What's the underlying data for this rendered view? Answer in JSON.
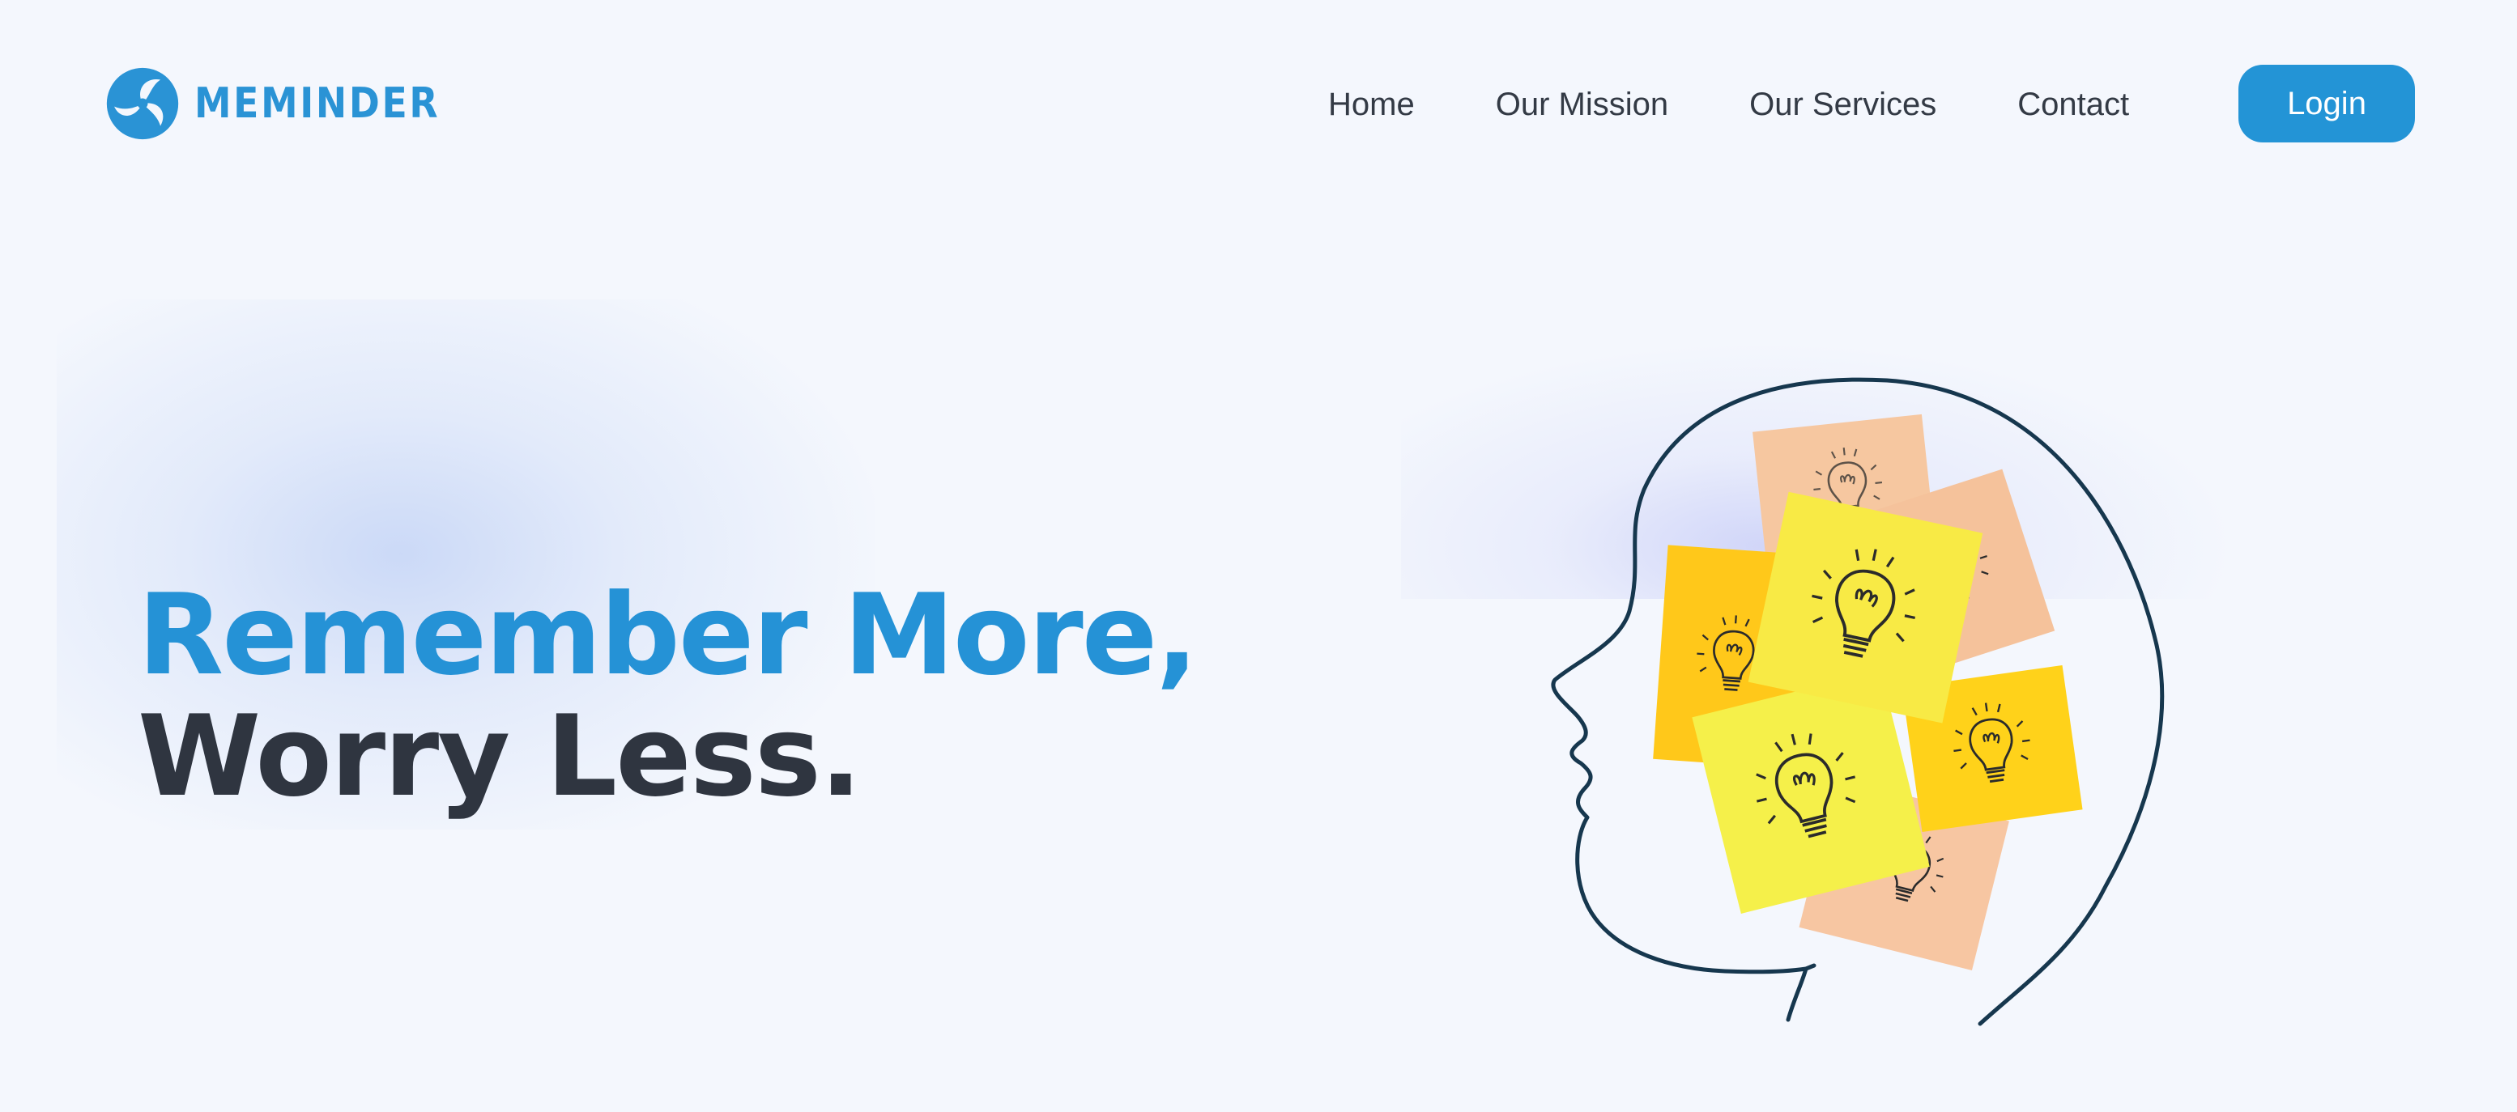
{
  "brand": {
    "name": "MEMINDER",
    "color": "#2a93d5",
    "logo_icon": "pinwheel-logo-icon"
  },
  "nav": {
    "items": [
      {
        "label": "Home"
      },
      {
        "label": "Our Mission"
      },
      {
        "label": "Our Services"
      },
      {
        "label": "Contact"
      }
    ],
    "login_label": "Login",
    "login_color": "#2394d6"
  },
  "hero": {
    "headline_line1": "Remember More,",
    "headline_line2": "Worry Less.",
    "line1_color": "#2592d6",
    "line2_color": "#2f3540"
  },
  "illustration": {
    "subject": "head-outline-with-sticky-notes-lightbulbs",
    "note_colors": [
      "#f6c7a0",
      "#f8e64a",
      "#ffd21a"
    ],
    "outline_color": "#16374e"
  },
  "colors": {
    "background": "#f4f7fd",
    "nav_text": "#333a45"
  }
}
